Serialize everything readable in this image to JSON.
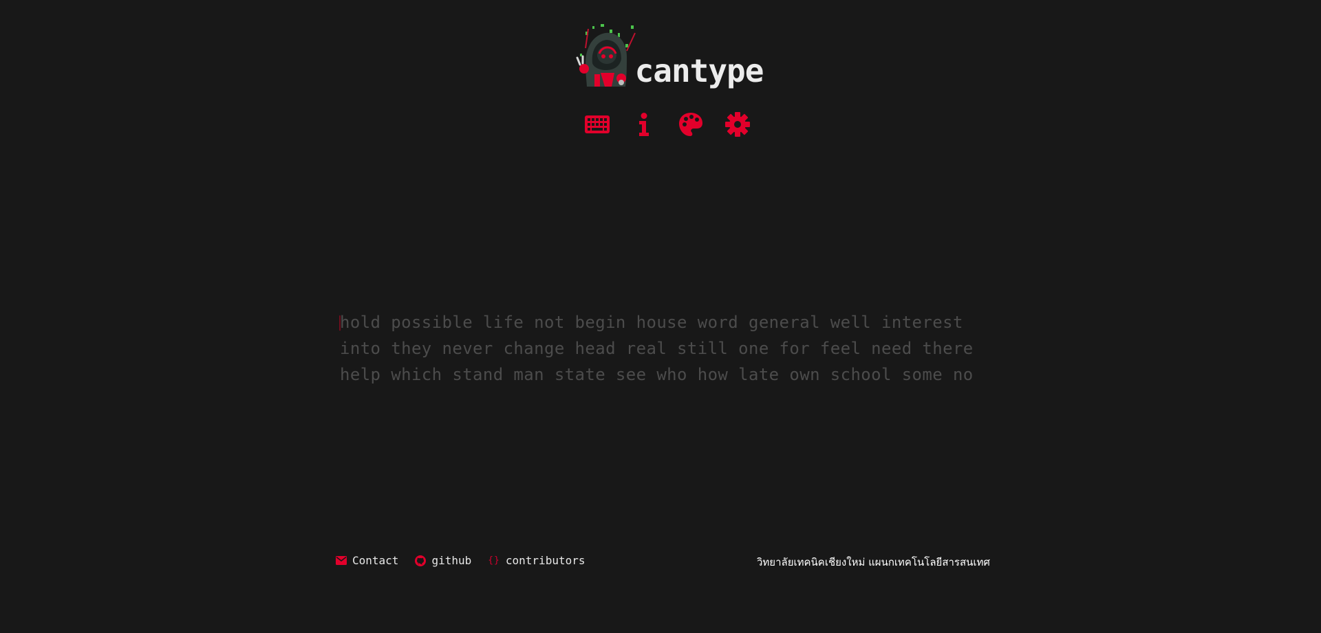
{
  "brand": {
    "name": "cantype",
    "logo_icon": "mascot-hacker-icon"
  },
  "nav": {
    "items": [
      {
        "icon": "keyboard-icon"
      },
      {
        "icon": "info-icon"
      },
      {
        "icon": "palette-icon"
      },
      {
        "icon": "gear-icon"
      }
    ]
  },
  "words": {
    "lines": [
      "hold possible life not begin house word general well interest",
      "into they never change head real still one for feel need there",
      "help which stand man state see who how late own school some no"
    ]
  },
  "footer": {
    "links": [
      {
        "label": "Contact",
        "icon": "envelope-icon"
      },
      {
        "label": "github",
        "icon": "github-icon"
      },
      {
        "label": "contributors",
        "icon": "braces-icon",
        "icon_text": "{}"
      }
    ],
    "organization": "วิทยาลัยเทคนิคเชียงใหม่ แผนกเทคโนโลยีสารสนเทศ"
  },
  "colors": {
    "background": "#181818",
    "accent": "#e2002b",
    "text": "#ececec",
    "untyped_word": "#4c4c4c"
  }
}
